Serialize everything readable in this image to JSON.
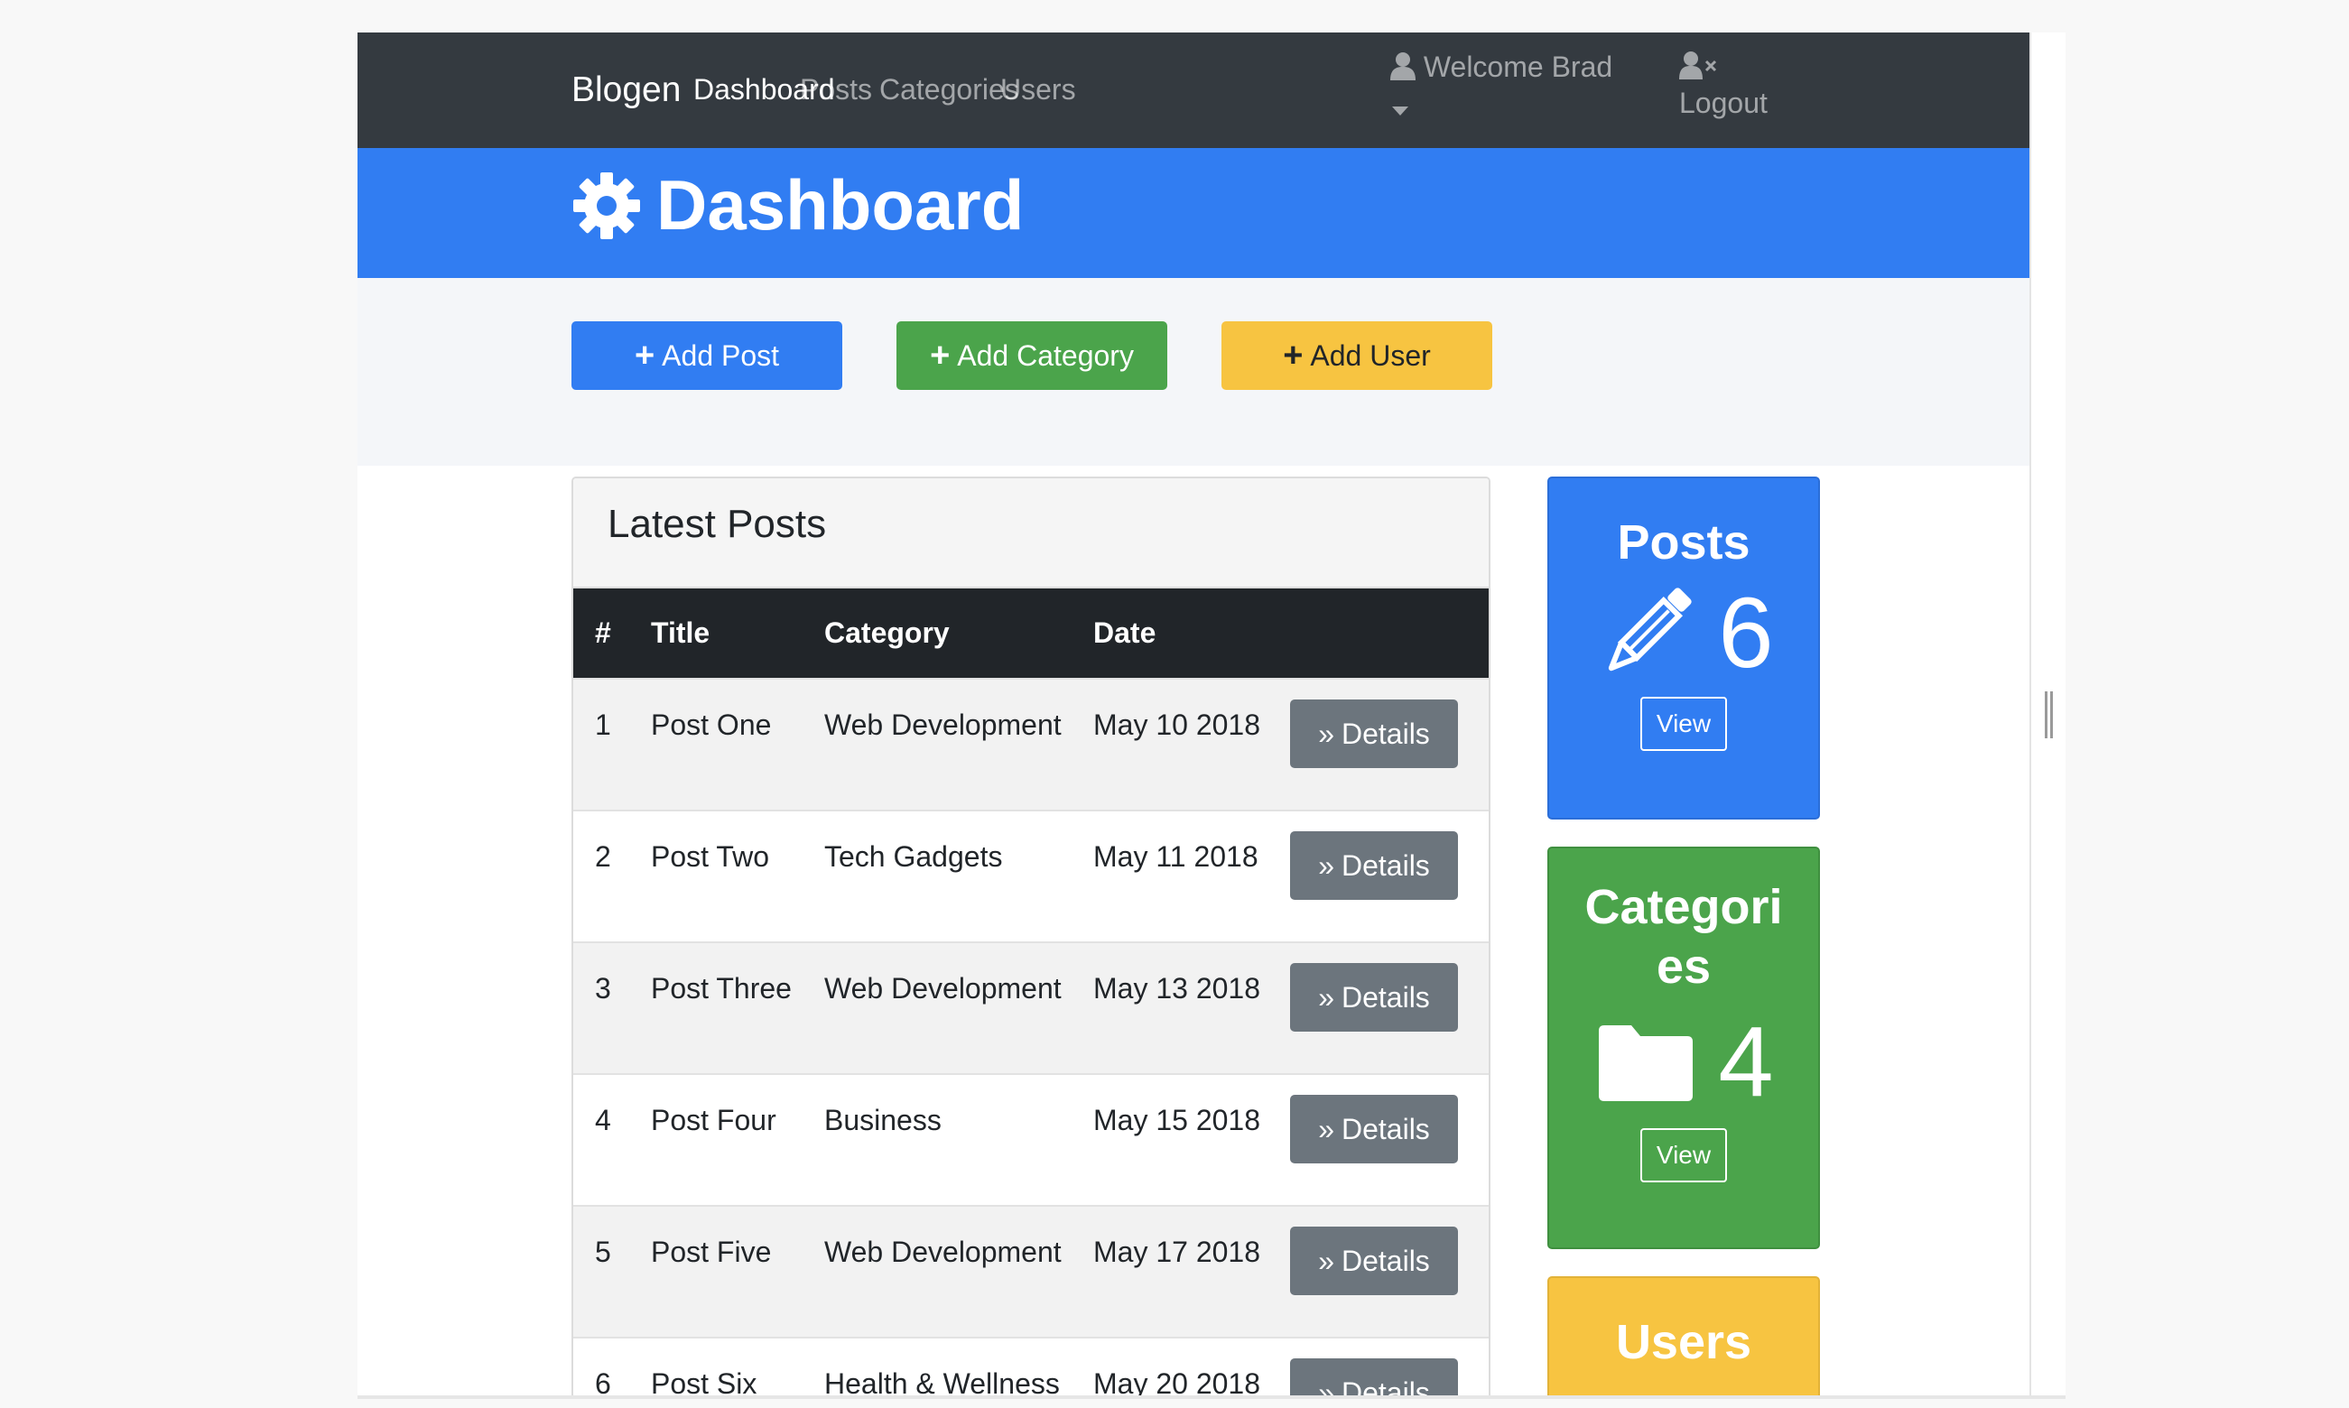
{
  "navbar": {
    "brand": "Blogen",
    "links": [
      "Dashboard",
      "Posts",
      "Categories",
      "Users"
    ],
    "welcome": "Welcome Brad",
    "logout": "Logout"
  },
  "header": {
    "title": "Dashboard",
    "icon": "gear-icon"
  },
  "actions": {
    "add_post": "Add Post",
    "add_category": "Add Category",
    "add_user": "Add User"
  },
  "latest_posts": {
    "title": "Latest Posts",
    "columns": [
      "#",
      "Title",
      "Category",
      "Date"
    ],
    "details_label": "Details",
    "rows": [
      {
        "num": "1",
        "title": "Post One",
        "category": "Web Development",
        "date": "May 10 2018"
      },
      {
        "num": "2",
        "title": "Post Two",
        "category": "Tech Gadgets",
        "date": "May 11 2018"
      },
      {
        "num": "3",
        "title": "Post Three",
        "category": "Web Development",
        "date": "May 13 2018"
      },
      {
        "num": "4",
        "title": "Post Four",
        "category": "Business",
        "date": "May 15 2018"
      },
      {
        "num": "5",
        "title": "Post Five",
        "category": "Web Development",
        "date": "May 17 2018"
      },
      {
        "num": "6",
        "title": "Post Six",
        "category": "Health & Wellness",
        "date": "May 20 2018"
      }
    ]
  },
  "stats": {
    "posts": {
      "title": "Posts",
      "count": "6",
      "view": "View"
    },
    "categories": {
      "title": "Categories",
      "count": "4",
      "view": "View"
    },
    "users": {
      "title": "Users"
    }
  },
  "colors": {
    "navbar": "#343a40",
    "primary": "#317df2",
    "success": "#4ba44b",
    "warning": "#f7c441",
    "secondary": "#6c757d"
  }
}
